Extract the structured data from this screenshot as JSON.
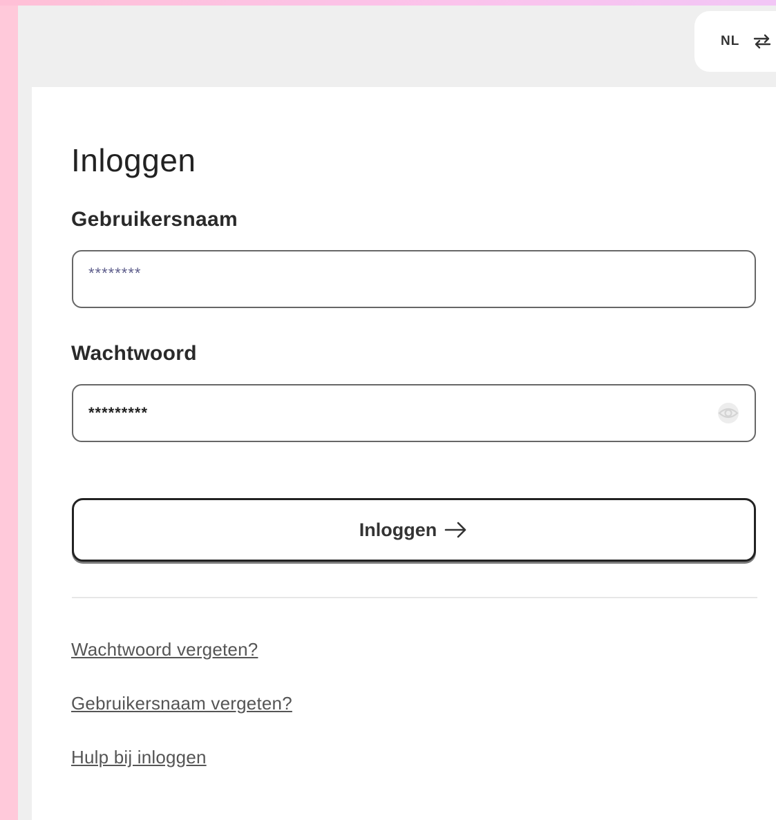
{
  "header": {
    "language_code": "NL"
  },
  "login": {
    "title": "Inloggen",
    "username": {
      "label": "Gebruikersnaam",
      "value": "********"
    },
    "password": {
      "label": "Wachtwoord",
      "value": "*********"
    },
    "submit_label": "Inloggen",
    "links": {
      "forgot_password": "Wachtwoord vergeten?",
      "forgot_username": "Gebruikersnaam vergeten?",
      "login_help": "Hulp bij inloggen"
    }
  },
  "icons": {
    "language_swap": "swap-arrows-icon",
    "password_visibility": "eye-icon",
    "submit_arrow": "arrow-right-icon"
  },
  "colors": {
    "page_border": "#ffc9da",
    "app_background": "#efefef",
    "card_background": "#ffffff",
    "text": "#222222",
    "input_border": "#666666",
    "button_border": "#222222",
    "link": "#555555"
  }
}
